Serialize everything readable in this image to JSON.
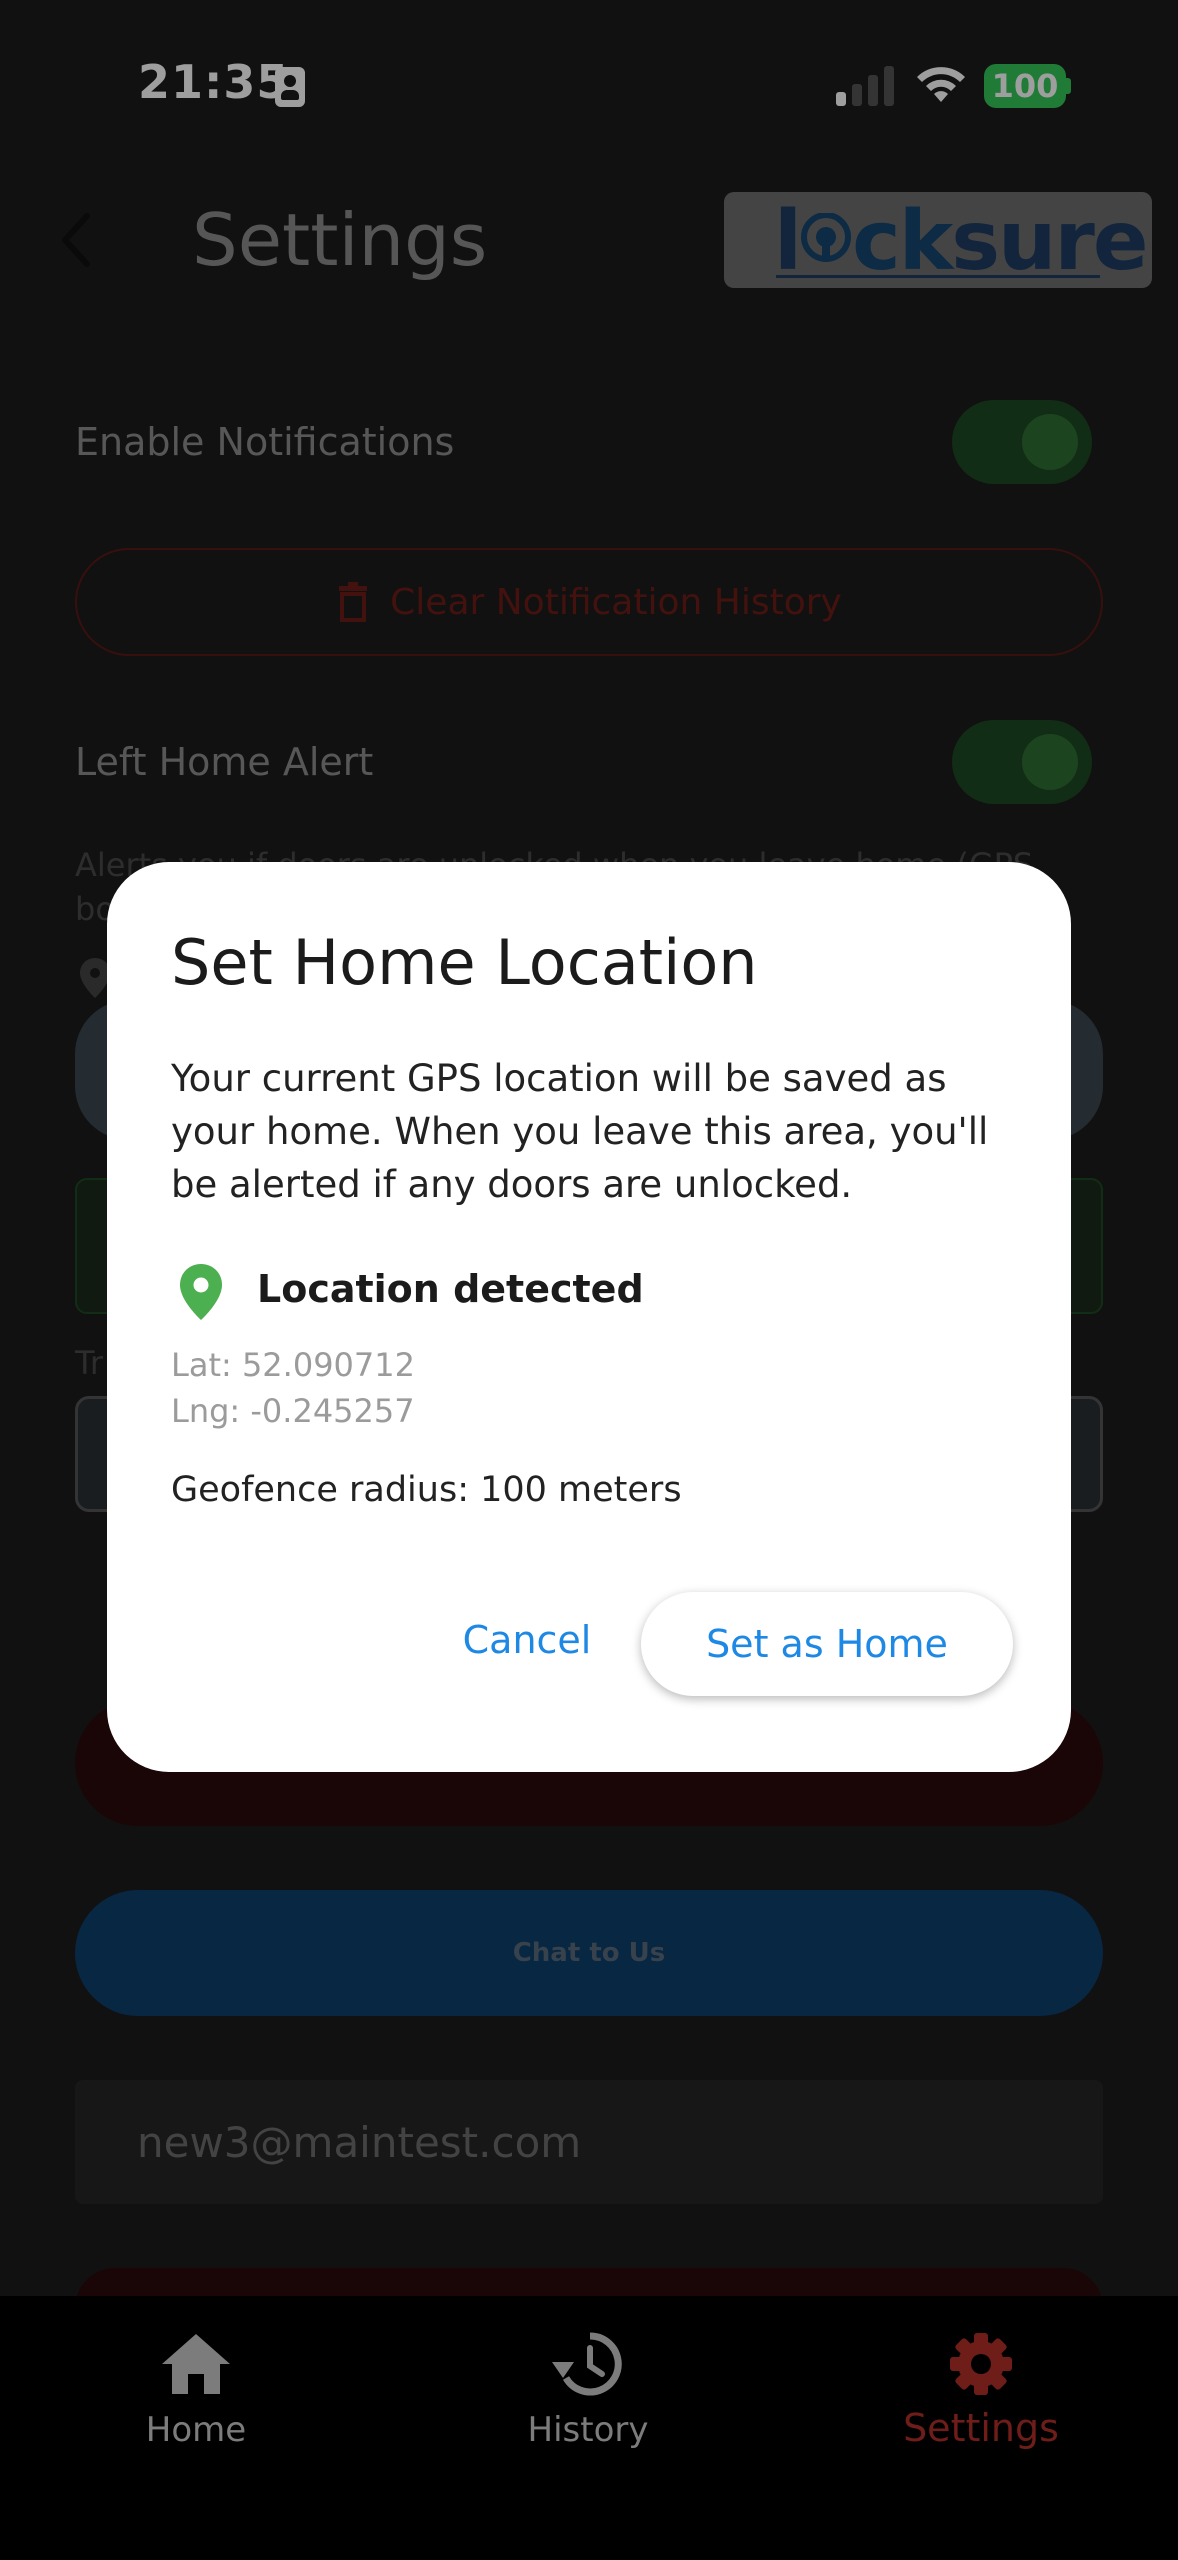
{
  "status_bar": {
    "time": "21:35",
    "battery": "100"
  },
  "header": {
    "title": "Settings",
    "logo_text_a": "l",
    "logo_text_b": "ck",
    "logo_text_c": "sure"
  },
  "settings": {
    "enable_notifications": "Enable Notifications",
    "clear_history": "Clear Notification History",
    "left_home_alert": "Left Home Alert",
    "alert_desc_line1": "Alerts you if doors are unlocked when you leave home (GPS",
    "alert_desc_line2": "bo",
    "partial_label": "Tr",
    "chat_label": "Chat to Us",
    "email": "new3@maintest.com"
  },
  "dialog": {
    "title": "Set Home Location",
    "body": "Your current GPS location will be saved as your home. When you leave this area, you'll be alerted if any doors are unlocked.",
    "location_status": "Location detected",
    "lat": "Lat: 52.090712",
    "lng": "Lng: -0.245257",
    "radius": "Geofence radius: 100 meters",
    "cancel": "Cancel",
    "confirm": "Set as Home"
  },
  "nav": {
    "items": [
      {
        "label": "Home",
        "icon": "home-icon"
      },
      {
        "label": "History",
        "icon": "history-icon"
      },
      {
        "label": "Settings",
        "icon": "gear-icon",
        "active": true
      }
    ]
  },
  "colors": {
    "accent": "#1e88e5",
    "danger": "#6e1d18",
    "success": "#34c759",
    "pin": "#4caf50"
  }
}
